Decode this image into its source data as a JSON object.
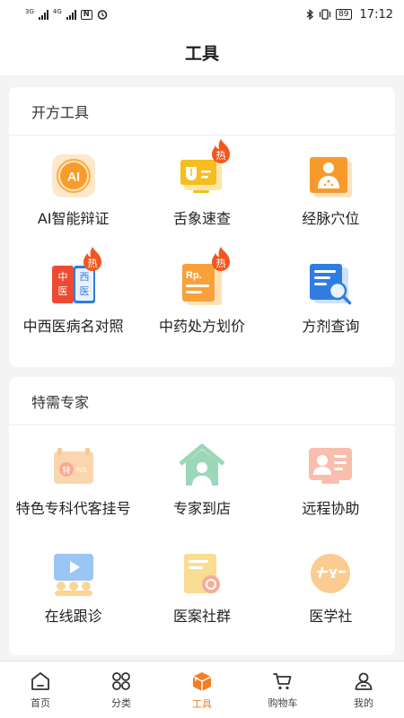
{
  "status": {
    "left_tags": [
      "3G",
      "4G"
    ],
    "battery": "89",
    "time": "17:12"
  },
  "header": {
    "title": "工具"
  },
  "sections": [
    {
      "title": "开方工具",
      "items": [
        {
          "label": "AI智能辩证",
          "icon": "ai-diagnosis-icon",
          "hot": false
        },
        {
          "label": "舌象速查",
          "icon": "tongue-check-icon",
          "hot": true
        },
        {
          "label": "经脉穴位",
          "icon": "acupoint-icon",
          "hot": false
        },
        {
          "label": "中西医病名对照",
          "icon": "disease-compare-icon",
          "hot": true
        },
        {
          "label": "中药处方划价",
          "icon": "prescription-price-icon",
          "hot": true
        },
        {
          "label": "方剂查询",
          "icon": "formula-search-icon",
          "hot": false
        }
      ]
    },
    {
      "title": "特需专家",
      "items": [
        {
          "label": "特色专科代客挂号",
          "icon": "registration-icon",
          "hot": false
        },
        {
          "label": "专家到店",
          "icon": "expert-visit-icon",
          "hot": false
        },
        {
          "label": "远程协助",
          "icon": "remote-assist-icon",
          "hot": false
        },
        {
          "label": "在线跟诊",
          "icon": "online-follow-icon",
          "hot": false
        },
        {
          "label": "医案社群",
          "icon": "case-community-icon",
          "hot": false
        },
        {
          "label": "医学社",
          "icon": "medical-club-icon",
          "hot": false
        }
      ]
    }
  ],
  "hot_badge": "热",
  "icon_text": {
    "ai": "AI",
    "rp": "Rp.",
    "zhong": "中",
    "yi": "医",
    "xi": "西",
    "te": "特",
    "no": "NO."
  },
  "tabbar": [
    {
      "label": "首页",
      "icon": "home-icon",
      "active": false
    },
    {
      "label": "分类",
      "icon": "category-icon",
      "active": false
    },
    {
      "label": "工具",
      "icon": "toolbox-icon",
      "active": true
    },
    {
      "label": "购物车",
      "icon": "cart-icon",
      "active": false
    },
    {
      "label": "我的",
      "icon": "profile-icon",
      "active": false
    }
  ],
  "colors": {
    "accent": "#f57d23",
    "hot": "#f2571e"
  }
}
